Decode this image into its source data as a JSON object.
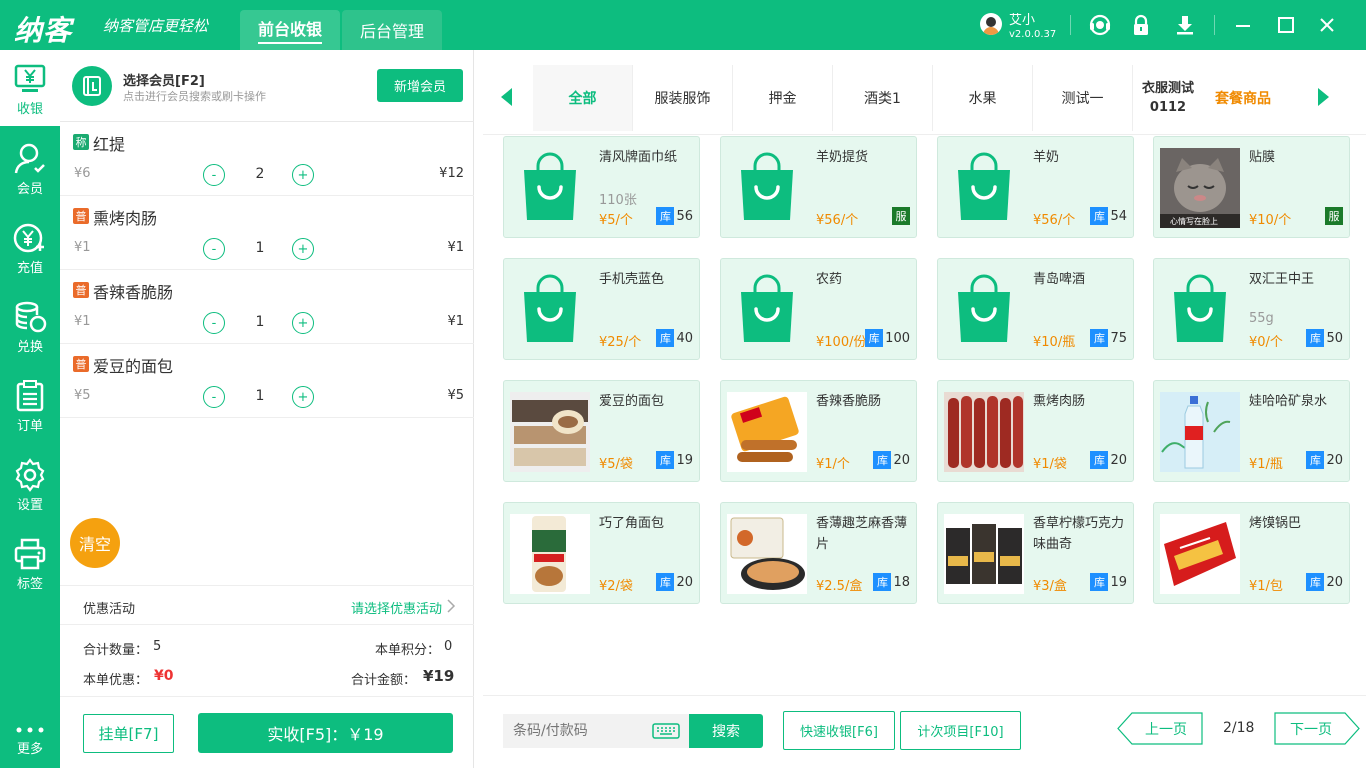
{
  "app": {
    "logo": "纳客",
    "slogan": "纳客管店更轻松"
  },
  "top_tabs": [
    {
      "label": "前台收银",
      "active": true
    },
    {
      "label": "后台管理",
      "active": false
    }
  ],
  "user": {
    "name": "艾小",
    "version": "v2.0.0.37"
  },
  "sidebar": [
    {
      "label": "收银",
      "icon": "cashier-icon",
      "active": true
    },
    {
      "label": "会员",
      "icon": "member-icon"
    },
    {
      "label": "充值",
      "icon": "recharge-icon"
    },
    {
      "label": "兑换",
      "icon": "exchange-icon"
    },
    {
      "label": "订单",
      "icon": "order-icon"
    },
    {
      "label": "设置",
      "icon": "settings-icon"
    },
    {
      "label": "标签",
      "icon": "print-icon"
    },
    {
      "label": "更多",
      "icon": "more-icon"
    }
  ],
  "member": {
    "title": "选择会员[F2]",
    "subtitle": "点击进行会员搜索或刷卡操作",
    "add_label": "新增会员"
  },
  "cart": [
    {
      "tag": "称",
      "name": "红提",
      "price": "¥6",
      "qty": "2",
      "total": "¥12"
    },
    {
      "tag": "普",
      "name": "熏烤肉肠",
      "price": "¥1",
      "qty": "1",
      "total": "¥1"
    },
    {
      "tag": "普",
      "name": "香辣香脆肠",
      "price": "¥1",
      "qty": "1",
      "total": "¥1"
    },
    {
      "tag": "普",
      "name": "爱豆的面包",
      "price": "¥5",
      "qty": "1",
      "total": "¥5"
    }
  ],
  "qty_minus": "-",
  "qty_plus": "+",
  "clear_label": "清空",
  "promo": {
    "label": "优惠活动",
    "select": "请选择优惠活动"
  },
  "totals": {
    "count_label": "合计数量：",
    "count": "5",
    "points_label": "本单积分：",
    "points": "0",
    "discount_label": "本单优惠：",
    "discount": "¥0",
    "amount_label": "合计金额：",
    "amount": "¥19"
  },
  "hold_label": "挂单[F7]",
  "pay_label": "实收[F5]：￥19",
  "categories": [
    "全部",
    "服装服饰",
    "押金",
    "酒类1",
    "水果",
    "测试一",
    "衣服测试0112",
    "套餐商品"
  ],
  "products": [
    {
      "name": "清风牌面巾纸",
      "spec": "110张",
      "price": "¥5/个",
      "stock": "56",
      "img": "bag"
    },
    {
      "name": "羊奶提货",
      "spec": "",
      "price": "¥56/个",
      "badge": "服",
      "img": "bag"
    },
    {
      "name": "羊奶",
      "spec": "",
      "price": "¥56/个",
      "stock": "54",
      "img": "bag"
    },
    {
      "name": "贴膜",
      "spec": "",
      "price": "¥10/个",
      "badge": "服",
      "img": "cat",
      "img_caption": "心情写在脸上"
    },
    {
      "name": "手机壳蓝色",
      "spec": "",
      "price": "¥25/个",
      "stock": "40",
      "img": "bag"
    },
    {
      "name": "农药",
      "spec": "",
      "price": "¥100/份",
      "stock": "100",
      "img": "bag"
    },
    {
      "name": "青岛啤酒",
      "spec": "",
      "price": "¥10/瓶",
      "stock": "75",
      "img": "bag"
    },
    {
      "name": "双汇王中王",
      "spec": "55g",
      "price": "¥0/个",
      "stock": "50",
      "img": "bag"
    },
    {
      "name": "爱豆的面包",
      "spec": "",
      "price": "¥5/袋",
      "stock": "19",
      "img": "bread"
    },
    {
      "name": "香辣香脆肠",
      "spec": "",
      "price": "¥1/个",
      "stock": "20",
      "img": "sausage"
    },
    {
      "name": "熏烤肉肠",
      "spec": "",
      "price": "¥1/袋",
      "stock": "20",
      "img": "ham"
    },
    {
      "name": "娃哈哈矿泉水",
      "spec": "",
      "price": "¥1/瓶",
      "stock": "20",
      "img": "water"
    },
    {
      "name": "巧了角面包",
      "spec": "",
      "price": "¥2/袋",
      "stock": "20",
      "img": "croissant"
    },
    {
      "name": "香薄趣芝麻香薄片",
      "spec": "",
      "price": "¥2.5/盒",
      "stock": "18",
      "img": "cracker"
    },
    {
      "name": "香草柠檬巧克力味曲奇",
      "spec": "",
      "price": "¥3/盒",
      "stock": "19",
      "img": "cookie"
    },
    {
      "name": "烤馍锅巴",
      "spec": "",
      "price": "¥1/包",
      "stock": "20",
      "img": "chips"
    }
  ],
  "stock_tag": "库",
  "search": {
    "placeholder": "条码/付款码",
    "button": "搜索"
  },
  "quick_label": "快速收银[F6]",
  "count_item_label": "计次项目[F10]",
  "pager": {
    "prev": "上一页",
    "page": "2/18",
    "next": "下一页"
  },
  "colors": {
    "primary": "#0dbd7f",
    "price": "#f08a00",
    "stock": "#1e90ff",
    "clear": "#f5a10f"
  }
}
